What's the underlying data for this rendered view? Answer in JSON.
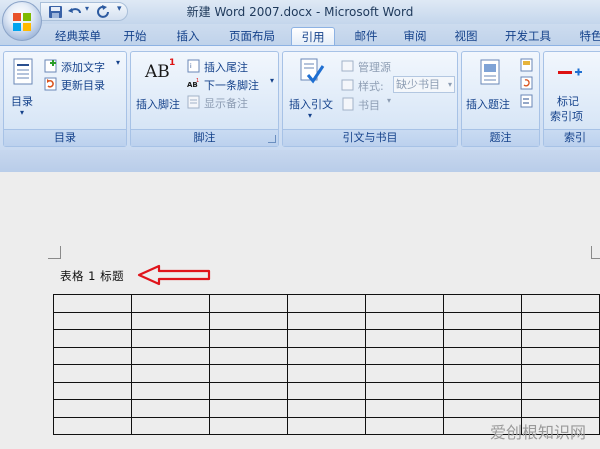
{
  "window": {
    "title": "新建 Word 2007.docx - Microsoft Word"
  },
  "quick_access": {
    "icons": [
      "save-icon",
      "undo-icon",
      "redo-icon",
      "customize-dropdown-icon"
    ]
  },
  "tabs": [
    {
      "label": "经典菜单",
      "active": false
    },
    {
      "label": "开始",
      "active": false
    },
    {
      "label": "插入",
      "active": false
    },
    {
      "label": "页面布局",
      "active": false
    },
    {
      "label": "引用",
      "active": true
    },
    {
      "label": "邮件",
      "active": false
    },
    {
      "label": "审阅",
      "active": false
    },
    {
      "label": "视图",
      "active": false
    },
    {
      "label": "开发工具",
      "active": false
    },
    {
      "label": "特色",
      "active": false
    }
  ],
  "ribbon": {
    "toc": {
      "group_label": "目录",
      "toc_button": "目录",
      "add_text": "添加文字",
      "update_toc": "更新目录"
    },
    "footnotes": {
      "group_label": "脚注",
      "insert_footnote": "插入脚注",
      "insert_endnote": "插入尾注",
      "next_footnote": "下一条脚注",
      "show_notes": "显示备注",
      "ab_glyph": "AB",
      "ab_superscript": "1"
    },
    "citations": {
      "group_label": "引文与书目",
      "insert_citation": "插入引文",
      "manage_sources": "管理源",
      "style_label": "样式:",
      "style_value": "缺少书目",
      "bibliography": "书目"
    },
    "captions": {
      "group_label": "题注",
      "insert_caption": "插入题注"
    },
    "index": {
      "group_label": "索引",
      "mark_entry_line1": "标记",
      "mark_entry_line2": "索引项"
    }
  },
  "document": {
    "caption": "表格 1 标题",
    "table": {
      "rows": 8,
      "cols": 7
    },
    "annotation_arrow_color": "#e0141b"
  },
  "watermark": "爱创根知识网",
  "colors": {
    "ribbon_text": "#15428b",
    "active_tab_border": "#8db2e3"
  }
}
